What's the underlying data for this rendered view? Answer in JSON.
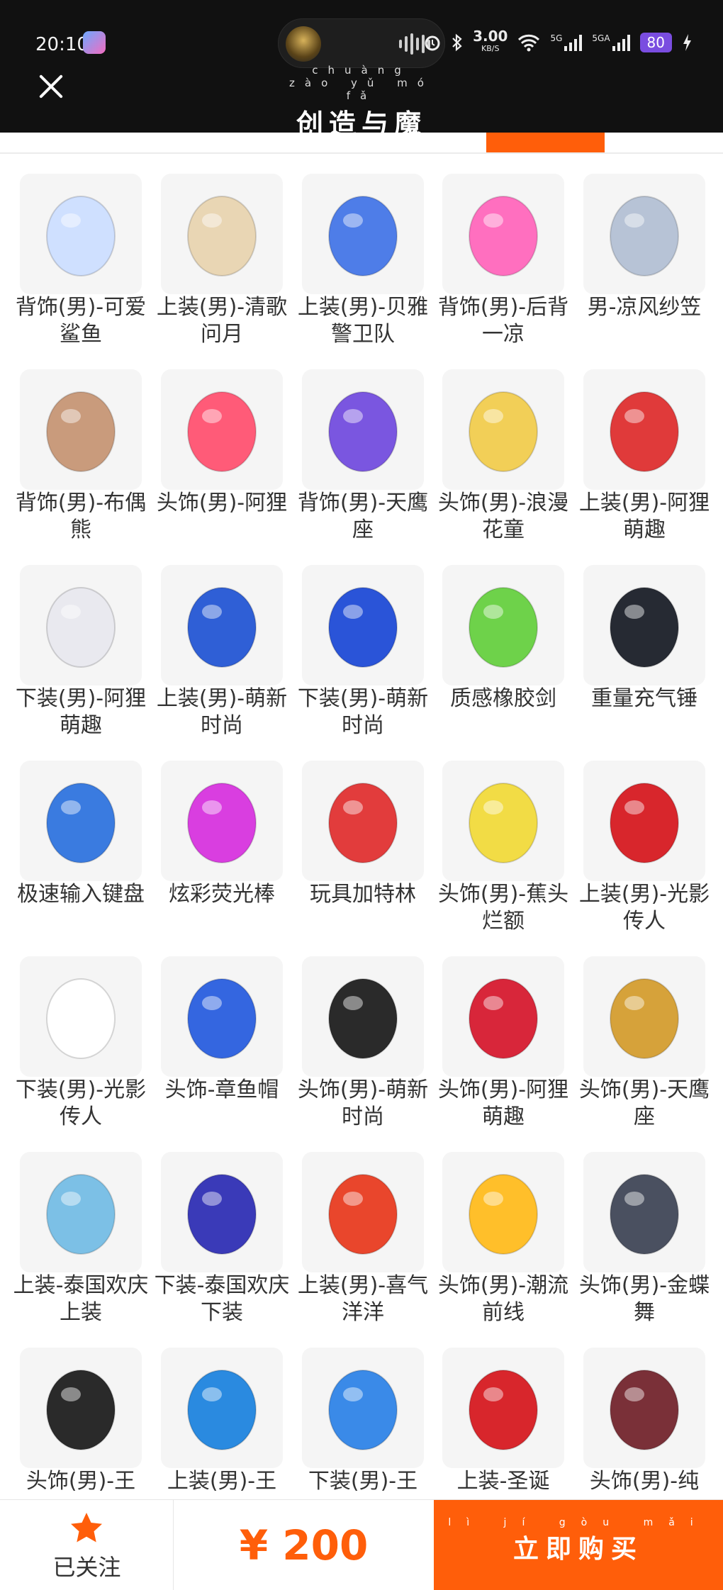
{
  "status_bar": {
    "time": "20:10",
    "network_speed": "3.00",
    "network_speed_unit": "KB/S",
    "signal_1": "5G",
    "signal_2": "5GA",
    "battery": "80"
  },
  "header": {
    "title": "创造与魔法",
    "title_pinyin": "chuàng zào yǔ mó fǎ"
  },
  "items": [
    {
      "name": "背饰(男)-可爱鲨鱼",
      "icon": "shark-backpack-icon"
    },
    {
      "name": "上装(男)-清歌问月",
      "icon": "robe-outfit-icon"
    },
    {
      "name": "上装(男)-贝雅警卫队",
      "icon": "armor-suit-icon"
    },
    {
      "name": "背饰(男)-后背一凉",
      "icon": "ice-cream-backpack-icon"
    },
    {
      "name": "男-凉风纱笠",
      "icon": "veil-hat-icon"
    },
    {
      "name": "背饰(男)-布偶熊",
      "icon": "teddy-bear-icon"
    },
    {
      "name": "头饰(男)-阿狸",
      "icon": "fox-mask-icon"
    },
    {
      "name": "背饰(男)-天鹰座",
      "icon": "mech-backpack-icon"
    },
    {
      "name": "头饰(男)-浪漫花童",
      "icon": "flower-head-icon"
    },
    {
      "name": "上装(男)-阿狸萌趣",
      "icon": "hoodie-icon"
    },
    {
      "name": "下装(男)-阿狸萌趣",
      "icon": "pants-icon"
    },
    {
      "name": "上装(男)-萌新时尚",
      "icon": "kimono-top-icon"
    },
    {
      "name": "下装(男)-萌新时尚",
      "icon": "blue-pants-icon"
    },
    {
      "name": "质感橡胶剑",
      "icon": "rubber-sword-icon"
    },
    {
      "name": "重量充气锤",
      "icon": "inflatable-hammer-icon"
    },
    {
      "name": "极速输入键盘",
      "icon": "keyboard-icon"
    },
    {
      "name": "炫彩荧光棒",
      "icon": "glow-stick-icon"
    },
    {
      "name": "玩具加特林",
      "icon": "toy-gatling-icon"
    },
    {
      "name": "头饰(男)-蕉头烂额",
      "icon": "banana-head-icon"
    },
    {
      "name": "上装(男)-光影传人",
      "icon": "red-jacket-icon"
    },
    {
      "name": "下装(男)-光影传人",
      "icon": "boots-icon"
    },
    {
      "name": "头饰-章鱼帽",
      "icon": "octopus-hat-icon"
    },
    {
      "name": "头饰(男)-萌新时尚",
      "icon": "hair-icon"
    },
    {
      "name": "头饰(男)-阿狸萌趣",
      "icon": "fox-ears-hair-icon"
    },
    {
      "name": "头饰(男)-天鹰座",
      "icon": "helmet-icon"
    },
    {
      "name": "上装-泰国欢庆上装",
      "icon": "thai-top-icon"
    },
    {
      "name": "下装-泰国欢庆下装",
      "icon": "thai-pants-icon"
    },
    {
      "name": "上装(男)-喜气洋洋",
      "icon": "tang-suit-icon"
    },
    {
      "name": "头饰(男)-潮流前线",
      "icon": "spiky-hair-icon"
    },
    {
      "name": "头饰(男)-金蝶舞",
      "icon": "butterfly-hair-icon"
    },
    {
      "name": "头饰(男)-王",
      "icon": "short-hair-icon"
    },
    {
      "name": "上装(男)-王",
      "icon": "blue-hoodie-icon"
    },
    {
      "name": "下装(男)-王",
      "icon": "jogger-pants-icon"
    },
    {
      "name": "上装-圣诞",
      "icon": "christmas-coat-icon"
    },
    {
      "name": "头饰(男)-纯",
      "icon": "red-hair-icon"
    }
  ],
  "bottom_bar": {
    "follow_label": "已关注",
    "price": "¥ 200",
    "buy_label": "立即购买",
    "buy_pinyin": "lì jí gòu mǎi"
  },
  "colors": {
    "accent": "#ff5e0a",
    "header_bg": "#111111",
    "thumb_bg": "#f5f5f5",
    "text": "#333333"
  }
}
